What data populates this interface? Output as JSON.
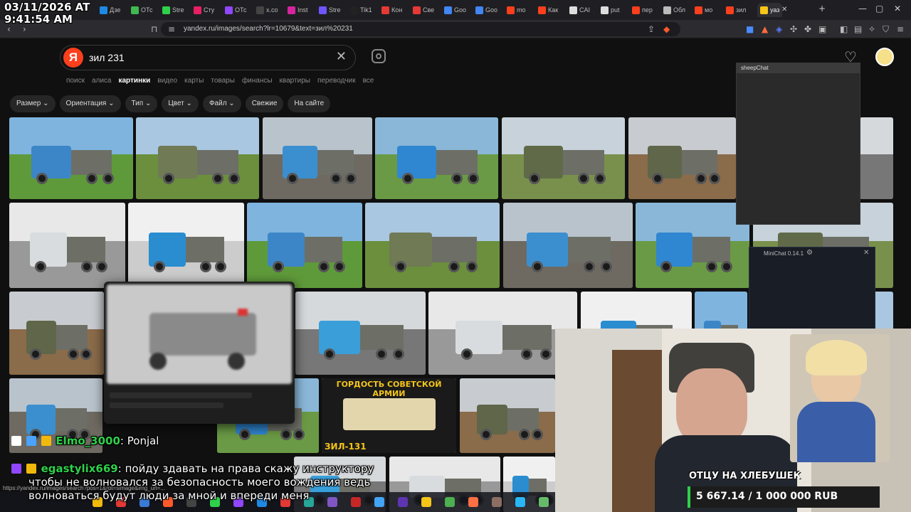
{
  "timestamp": {
    "date": "03/11/2026 AT",
    "time": "9:41:54 AM"
  },
  "tabs": [
    {
      "label": "Дзе",
      "fav": "#1e88e5"
    },
    {
      "label": "ОТс",
      "fav": "#3fb950"
    },
    {
      "label": "Stre",
      "fav": "#2fd14a"
    },
    {
      "label": "Сту",
      "fav": "#e91e63"
    },
    {
      "label": "ОТс",
      "fav": "#9147ff"
    },
    {
      "label": "x.co",
      "fav": "#444444"
    },
    {
      "label": "Inst",
      "fav": "#d6249f"
    },
    {
      "label": "Stre",
      "fav": "#6e55ff"
    },
    {
      "label": "Tik1",
      "fav": "#222222"
    },
    {
      "label": "Кон",
      "fav": "#e53935"
    },
    {
      "label": "Све",
      "fav": "#e53935"
    },
    {
      "label": "Goo",
      "fav": "#4285f4"
    },
    {
      "label": "Goo",
      "fav": "#4285f4"
    },
    {
      "label": "mo",
      "fav": "#fc3f1d"
    },
    {
      "label": "Как",
      "fav": "#fc3f1d"
    },
    {
      "label": "CAI",
      "fav": "#dddddd"
    },
    {
      "label": "put",
      "fav": "#dddddd"
    },
    {
      "label": "пер",
      "fav": "#fc3f1d"
    },
    {
      "label": "Обл",
      "fav": "#bbbbbb"
    },
    {
      "label": "мо",
      "fav": "#fc3f1d"
    },
    {
      "label": "зил",
      "fav": "#fc3f1d"
    },
    {
      "label": "уаз",
      "fav": "#f5c518"
    }
  ],
  "address": {
    "url": "yandex.ru/images/search?lr=10679&text=зил%20231"
  },
  "search": {
    "query": "зил 231",
    "logo": "Я"
  },
  "services": [
    "поиск",
    "алиса",
    "картинки",
    "видео",
    "карты",
    "товары",
    "финансы",
    "квартиры",
    "переводчик",
    "все"
  ],
  "active_service": "картинки",
  "filters": [
    "Размер",
    "Ориентация",
    "Тип",
    "Цвет",
    "Файл",
    "Свежие",
    "На сайте"
  ],
  "tile_banner": {
    "top": "ГОРДОСТЬ СОВЕТСКОЙ АРМИИ",
    "bottom": "ЗИЛ-131"
  },
  "overlays": {
    "sheepchat_title": "sheepChat",
    "minichat_title": "MiniChat 0.14.1",
    "cam_caption": "ОТЦУ НА ХЛЕБУШЕК",
    "goal": "5 667.14 / 1 000 000 RUB"
  },
  "chat": [
    {
      "user": "Elmo_3000",
      "user_color": "#2fd14a",
      "message": "Ponjal"
    },
    {
      "user": "egastylix669",
      "user_color": "#2fd14a",
      "message": "пойду здавать на права скажу инструктору",
      "line2": "чтобы не волновался за безопасность моего вождения ведь",
      "line3": "волноваться будут люди за мной и впереди меня"
    }
  ],
  "status_url": "https://yandex.ru/images/search?pos=1&rpt=simage&img_url=..."
}
